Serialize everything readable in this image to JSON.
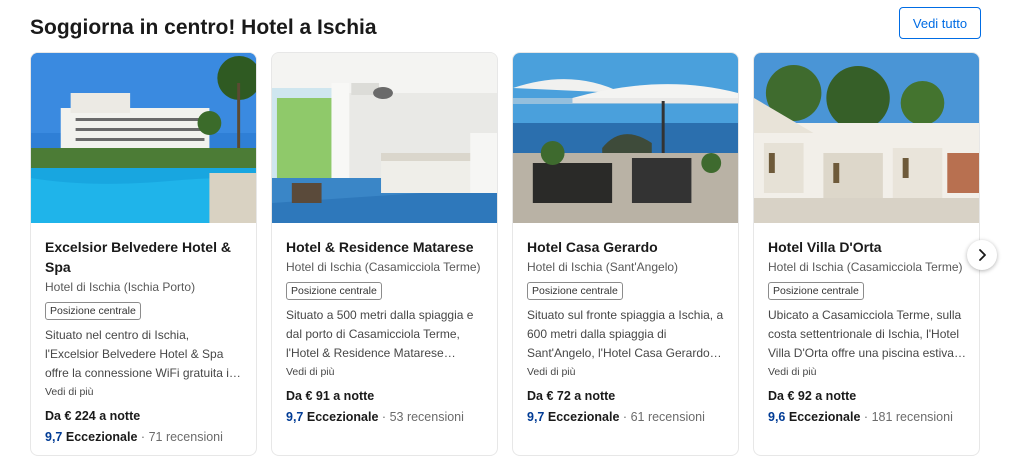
{
  "section": {
    "title": "Soggiorna in centro! Hotel a Ischia",
    "see_all": "Vedi tutto"
  },
  "hotels": [
    {
      "name": "Excelsior Belvedere Hotel & Spa",
      "location": "Hotel di Ischia (Ischia Porto)",
      "badge": "Posizione centrale",
      "description": "Situato nel centro di Ischia, l'Excelsior Belvedere Hotel & Spa offre la connessione WiFi gratuita i…",
      "more": "Vedi di più",
      "price": "Da € 224 a notte",
      "score": "9,7",
      "score_label": "Eccezionale",
      "separator": " · ",
      "reviews": "71 recensioni"
    },
    {
      "name": "Hotel & Residence Matarese",
      "location": "Hotel di Ischia (Casamicciola Terme)",
      "badge": "Posizione centrale",
      "description": "Situato a 500 metri dalla spiaggia e dal porto di Casamicciola Terme, l'Hotel & Residence Matarese vanta…",
      "more": "Vedi di più",
      "price": "Da € 91 a notte",
      "score": "9,7",
      "score_label": "Eccezionale",
      "separator": " · ",
      "reviews": "53 recensioni"
    },
    {
      "name": "Hotel Casa Gerardo",
      "location": "Hotel di Ischia (Sant'Angelo)",
      "badge": "Posizione centrale",
      "description": "Situato sul fronte spiaggia a Ischia, a 600 metri dalla spiaggia di Sant'Angelo, l'Hotel Casa Gerardo…",
      "more": "Vedi di più",
      "price": "Da € 72 a notte",
      "score": "9,7",
      "score_label": "Eccezionale",
      "separator": " · ",
      "reviews": "61 recensioni"
    },
    {
      "name": "Hotel Villa D'Orta",
      "location": "Hotel di Ischia (Casamicciola Terme)",
      "badge": "Posizione centrale",
      "description": "Ubicato a Casamicciola Terme, sulla costa settentrionale di Ischia, l'Hotel Villa D'Orta offre una piscina estiva…",
      "more": "Vedi di più",
      "price": "Da € 92 a notte",
      "score": "9,6",
      "score_label": "Eccezionale",
      "separator": " · ",
      "reviews": "181 recensioni"
    }
  ],
  "icons": {
    "next": "chevron-right-icon"
  },
  "colors": {
    "accent": "#006ce4",
    "score": "#003b95"
  }
}
